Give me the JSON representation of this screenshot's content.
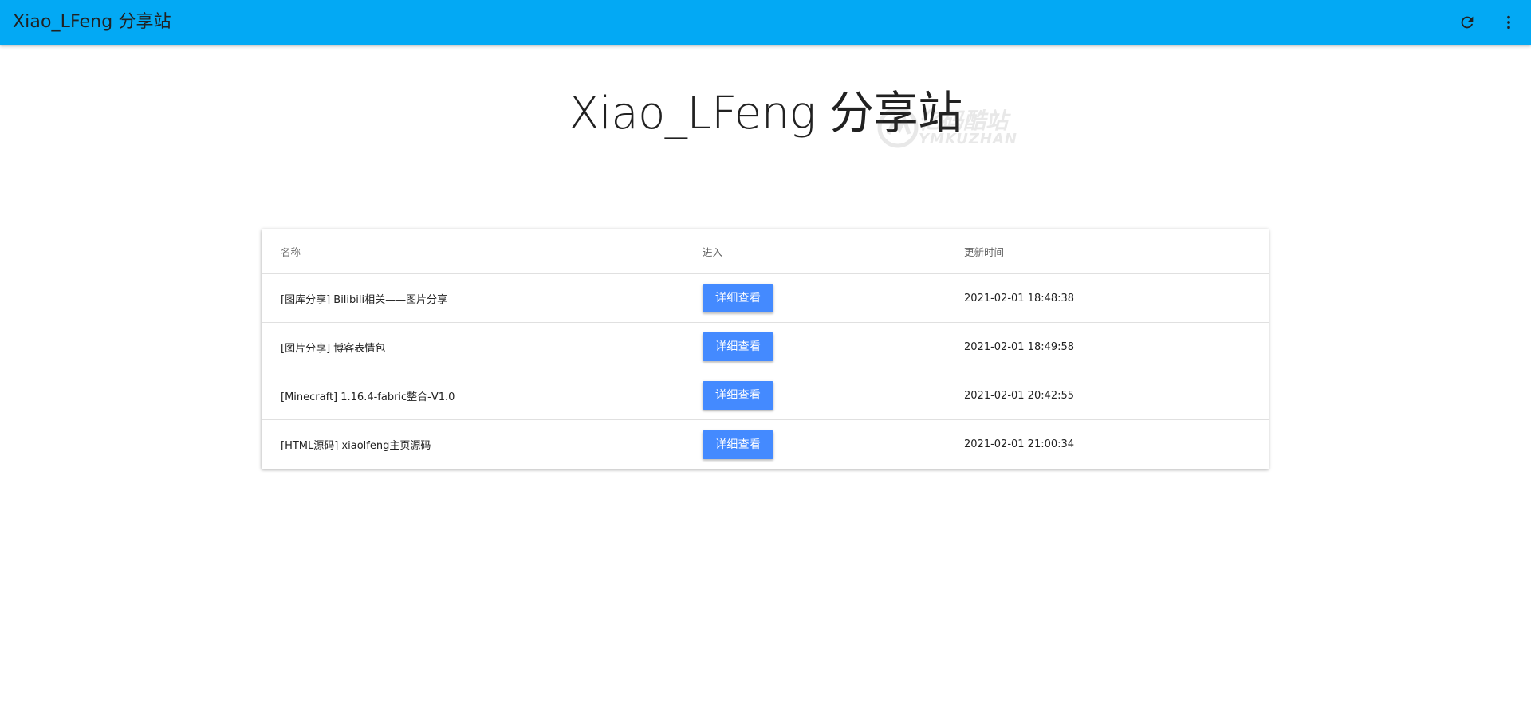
{
  "appbar": {
    "title": "Xiao_LFeng 分享站",
    "refresh_icon": "refresh-icon",
    "more_icon": "more-vertical-icon",
    "color": "#03a9f4"
  },
  "hero": {
    "title": "Xiao_LFeng 分享站"
  },
  "watermark": {
    "text_cn": "亿码酷站",
    "text_en": "YMKUZHAN"
  },
  "table": {
    "headers": {
      "name": "名称",
      "enter": "进入",
      "updated": "更新时间"
    },
    "rows": [
      {
        "name": "[图库分享] Bilibili相关——图片分享",
        "button": "详细查看",
        "time": "2021-02-01 18:48:38"
      },
      {
        "name": "[图片分享] 博客表情包",
        "button": "详细查看",
        "time": "2021-02-01 18:49:58"
      },
      {
        "name": "[Minecraft] 1.16.4-fabric整合-V1.0",
        "button": "详细查看",
        "time": "2021-02-01 20:42:55"
      },
      {
        "name": "[HTML源码] xiaolfeng主页源码",
        "button": "详细查看",
        "time": "2021-02-01 21:00:34"
      }
    ],
    "button_color": "#448aff"
  }
}
